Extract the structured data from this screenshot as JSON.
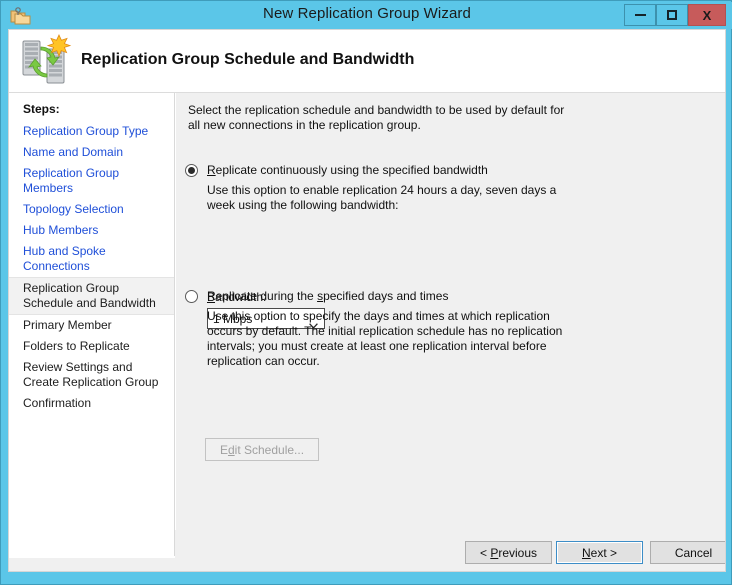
{
  "window": {
    "title": "New Replication Group Wizard",
    "icon": "folders-icon",
    "controls": {
      "minimize": "minimize-icon",
      "maximize": "maximize-icon",
      "close_label": "X"
    },
    "titlebar_color": "#5bc6e8",
    "close_button_color": "#c75b5b"
  },
  "banner": {
    "icon": "replication-servers-icon",
    "title": "Replication Group Schedule and Bandwidth"
  },
  "sidebar": {
    "heading": "Steps:",
    "items": [
      {
        "label": "Replication Group Type",
        "state": "done"
      },
      {
        "label": "Name and Domain",
        "state": "done"
      },
      {
        "label": "Replication Group Members",
        "state": "done"
      },
      {
        "label": "Topology Selection",
        "state": "done"
      },
      {
        "label": "Hub Members",
        "state": "done"
      },
      {
        "label": "Hub and Spoke Connections",
        "state": "done"
      },
      {
        "label": "Replication Group Schedule and Bandwidth",
        "state": "current"
      },
      {
        "label": "Primary Member",
        "state": "future"
      },
      {
        "label": "Folders to Replicate",
        "state": "future"
      },
      {
        "label": "Review Settings and Create Replication Group",
        "state": "future"
      },
      {
        "label": "Confirmation",
        "state": "future"
      }
    ]
  },
  "content": {
    "intro": "Select the replication schedule and bandwidth to be used by default for all new connections in the replication group.",
    "options": [
      {
        "id": "continuous",
        "label_prefix": "",
        "label_accel": "R",
        "label_suffix": "eplicate continuously using the specified bandwidth",
        "selected": true,
        "description": "Use this option to enable replication 24 hours a day, seven days a week using the following bandwidth:"
      },
      {
        "id": "scheduled",
        "label_prefix": "Replicate during the ",
        "label_accel": "s",
        "label_suffix": "pecified days and times",
        "selected": false,
        "description": "Use this option to specify the days and times at which replication occurs by default. The initial replication schedule has no replication intervals; you must create at least one replication interval before replication can occur."
      }
    ],
    "bandwidth": {
      "label_accel": "B",
      "label_suffix": "andwidth:",
      "value": "1 Mbps",
      "options": [
        "1 Mbps"
      ]
    },
    "edit_schedule": {
      "prefix": "E",
      "accel": "d",
      "suffix": "it Schedule...",
      "enabled": false
    }
  },
  "footer": {
    "buttons": [
      {
        "id": "previous",
        "prefix": "< ",
        "accel": "P",
        "suffix": "revious",
        "default": false
      },
      {
        "id": "next",
        "prefix": "",
        "accel": "N",
        "suffix": "ext >",
        "default": true
      },
      {
        "id": "cancel",
        "prefix": "Cancel",
        "accel": "",
        "suffix": "",
        "default": false
      }
    ]
  }
}
